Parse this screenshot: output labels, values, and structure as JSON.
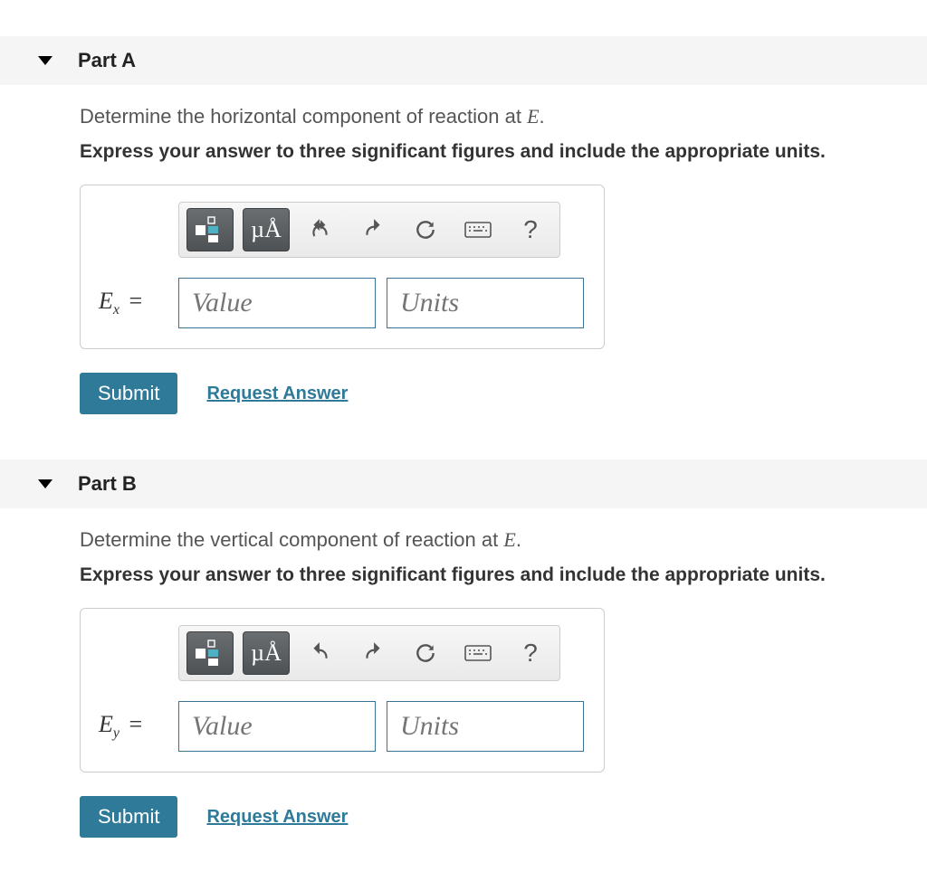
{
  "parts": [
    {
      "title": "Part A",
      "question_prefix": "Determine the horizontal component of reaction at ",
      "question_var": "E",
      "question_suffix": ".",
      "instruction": "Express your answer to three significant figures and include the appropriate units.",
      "lhs_main": "E",
      "lhs_sub": "x",
      "eq": "=",
      "value_placeholder": "Value",
      "units_placeholder": "Units",
      "submit": "Submit",
      "request": "Request Answer",
      "tool_units": "µÅ"
    },
    {
      "title": "Part B",
      "question_prefix": "Determine the vertical component of reaction at ",
      "question_var": "E",
      "question_suffix": ".",
      "instruction": "Express your answer to three significant figures and include the appropriate units.",
      "lhs_main": "E",
      "lhs_sub": "y",
      "eq": "=",
      "value_placeholder": "Value",
      "units_placeholder": "Units",
      "submit": "Submit",
      "request": "Request Answer",
      "tool_units": "µÅ"
    }
  ]
}
